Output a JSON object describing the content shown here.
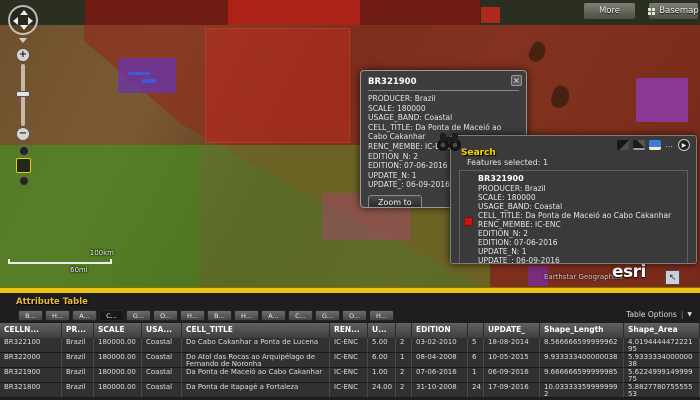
{
  "colors": {
    "accent_yellow": "#ecc214",
    "search_title_yellow": "#ffd400",
    "table_title_gold": "#e8b93d",
    "selection_red": "#c41414",
    "overlay_red": "#96241a",
    "overlay_green": "#55962a",
    "overlay_purple": "#6934aa",
    "panel_bg": "#3a3a3a"
  },
  "icons": {
    "zoom_in": "+",
    "zoom_out": "−",
    "collapse_arrow": "▶",
    "overview_arrow": "↖"
  },
  "map": {
    "more_button": "More",
    "basemap_button": "Basemap",
    "scalebar_km": "100km",
    "scalebar_mi": "60mi",
    "attribution": "Earthstar Geographics",
    "logo": "esri"
  },
  "popup": {
    "title": "BR321900",
    "close_icon": "×",
    "fields": [
      "PRODUCER: Brazil",
      "SCALE: 180000",
      "USAGE_BAND: Coastal",
      "CELL_TITLE: Da Ponta de Maceió ao Cabo Cakanhar",
      "RENC_MEMBE: IC-ENC",
      "EDITION_N: 2",
      "EDITION: 07-06-2016",
      "UPDATE_N: 1",
      "UPDATE_: 06-09-2016"
    ],
    "zoom_to": "Zoom to"
  },
  "search": {
    "title": "Search",
    "overflow_icon": "…",
    "status": "Features selected: 1",
    "result_title": "BR321900",
    "result_fields": [
      "PRODUCER: Brazil",
      "SCALE: 180000",
      "USAGE_BAND: Coastal",
      "CELL_TITLE: Da Ponta de Maceió ao Cabo Cakanhar",
      "RENC_MEMBE: IC-ENC",
      "EDITION_N: 2",
      "EDITION: 07-06-2016",
      "UPDATE_N: 1",
      "UPDATE_: 06-09-2016"
    ]
  },
  "table": {
    "title": "Attribute Table",
    "options_label": "Table Options",
    "options_sep": "|",
    "options_arrow": "▼",
    "tabs": [
      "B...",
      "H...",
      "A...",
      "C...",
      "G...",
      "O...",
      "H...",
      "B...",
      "H...",
      "A...",
      "C...",
      "G...",
      "O...",
      "H..."
    ],
    "columns": [
      "CELLN...",
      "PR...",
      "SCALE",
      "USA...",
      "CELL_TITLE",
      "REN...",
      "U...",
      "",
      "EDITION",
      "",
      "UPDATE_",
      "Shape_Length",
      "Shape_Area"
    ],
    "rows": [
      [
        "BR322100",
        "Brazil",
        "180000.00",
        "Coastal",
        "Do Cabo Cakanhar a Ponta de Lucena",
        "IC-ENC",
        "5.00",
        "2",
        "03-02-2010",
        "5",
        "18-08-2014",
        "8.566666599999962",
        "4.019444447222195"
      ],
      [
        "BR322000",
        "Brazil",
        "180000.00",
        "Coastal",
        "Do Atol das Rocas ao Arquipélago de Fernando de Noronha",
        "IC-ENC",
        "6.00",
        "1",
        "08-04-2008",
        "6",
        "10-05-2015",
        "9.933333400000038",
        "5.933333400000038"
      ],
      [
        "BR321900",
        "Brazil",
        "180000.00",
        "Coastal",
        "Da Ponta de Maceió ao Cabo Cakanhar",
        "IC-ENC",
        "1.00",
        "2",
        "07-06-2016",
        "1",
        "06-09-2016",
        "9.666666599999985",
        "5.622499914999975"
      ],
      [
        "BR321800",
        "Brazil",
        "180000.00",
        "Coastal",
        "Da Ponta de Itapagé a Fortaleza",
        "IC-ENC",
        "24.00",
        "2",
        "31-10-2008",
        "24",
        "17-09-2016",
        "10.033333599999992",
        "5.882778075555553"
      ]
    ]
  }
}
